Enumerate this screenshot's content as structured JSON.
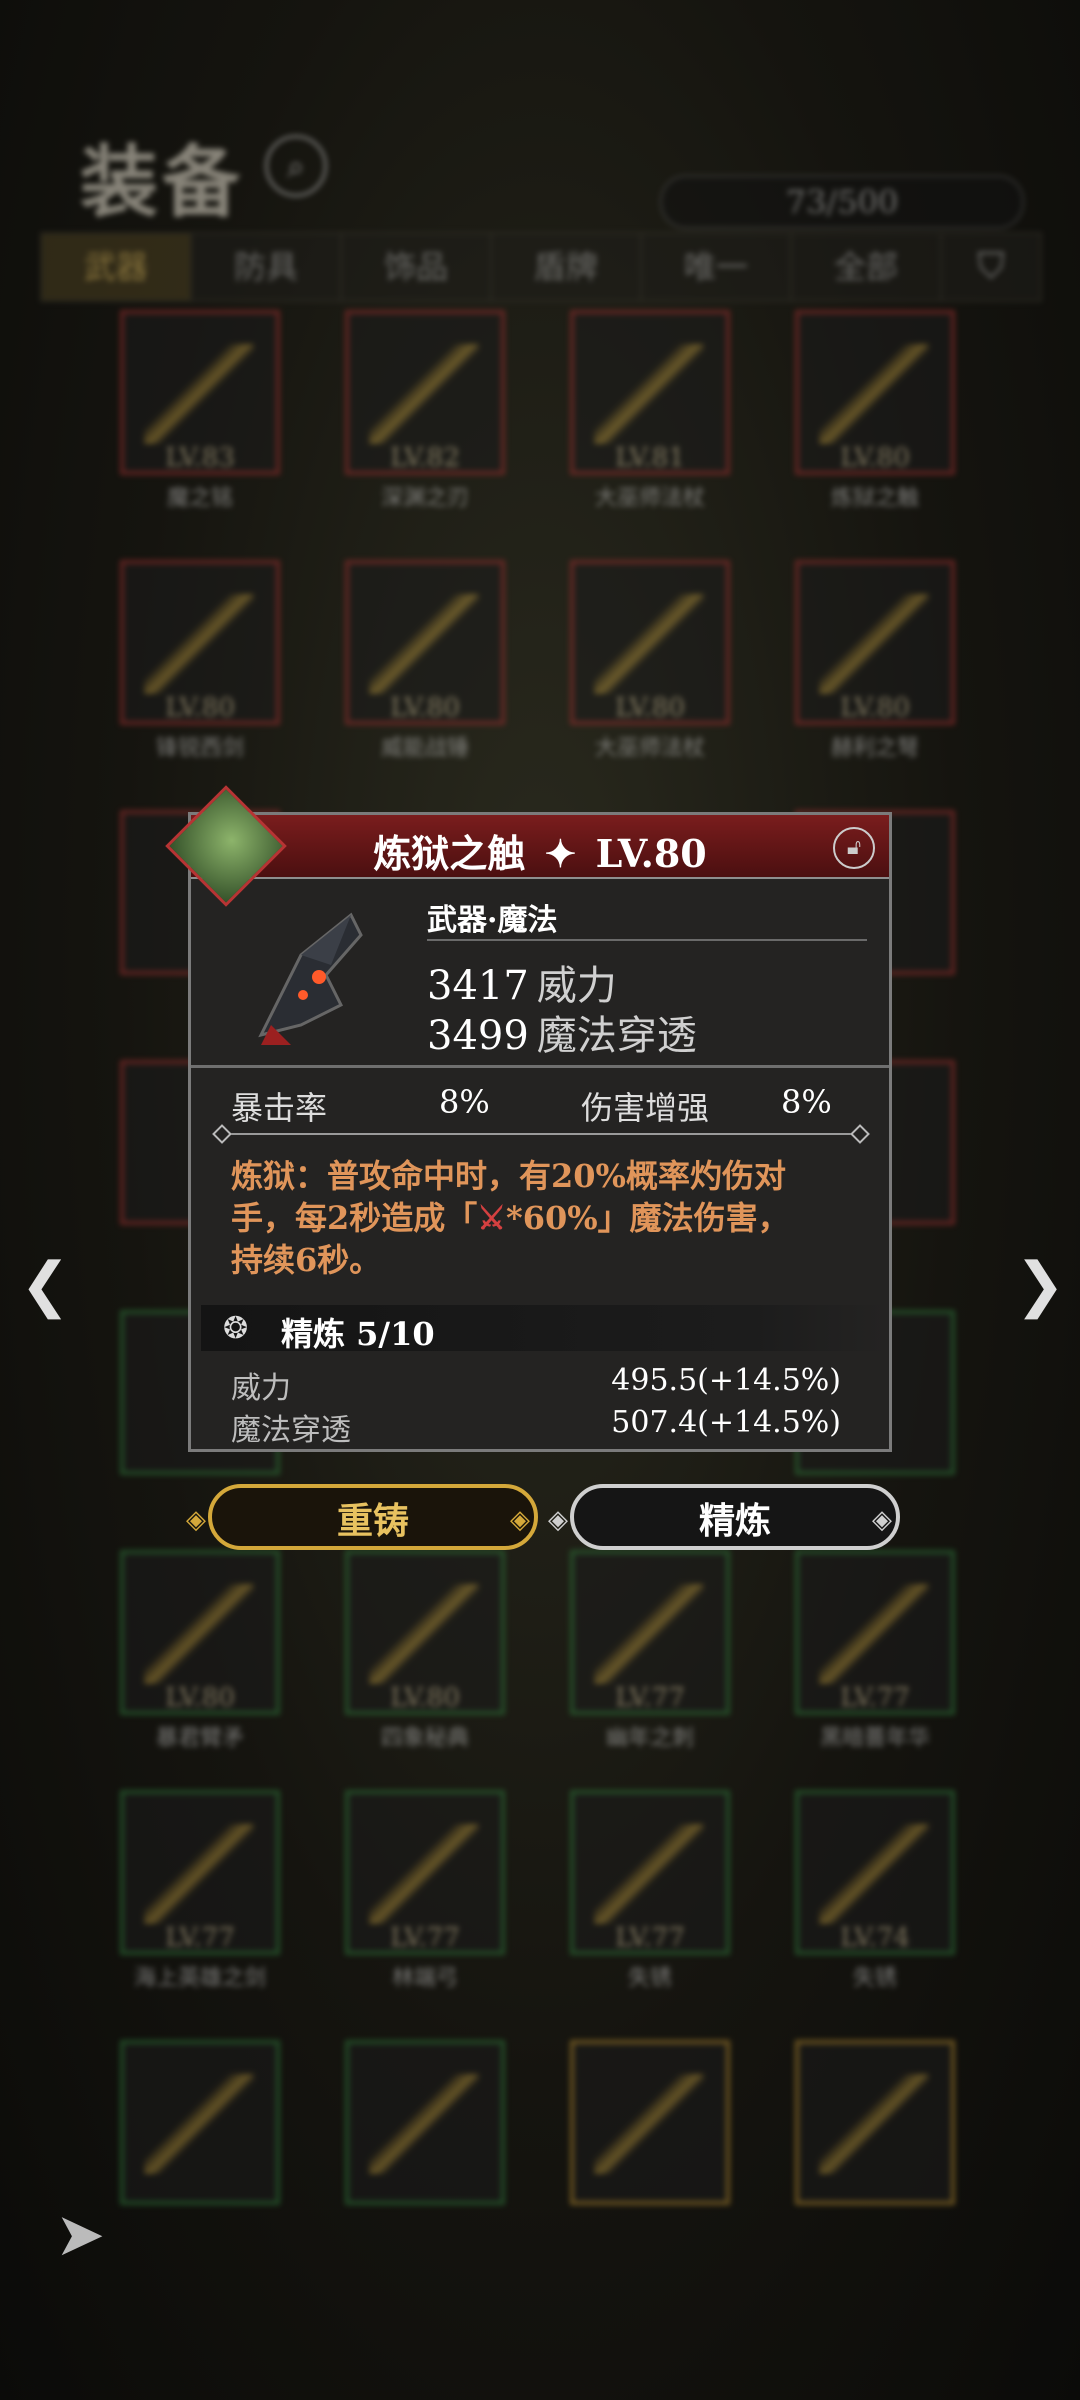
{
  "header": {
    "title": "装备",
    "capacity": "73/500"
  },
  "tabs": [
    {
      "label": "武器",
      "active": true
    },
    {
      "label": "防具",
      "active": false
    },
    {
      "label": "饰品",
      "active": false
    },
    {
      "label": "盾牌",
      "active": false
    },
    {
      "label": "唯一",
      "active": false
    },
    {
      "label": "全部",
      "active": false
    }
  ],
  "grid_items": [
    {
      "level": "LV.83",
      "name": "魔之铭",
      "border": "red"
    },
    {
      "level": "LV.82",
      "name": "深渊之刃",
      "border": "red"
    },
    {
      "level": "LV.81",
      "name": "大巫师法杖",
      "border": "red"
    },
    {
      "level": "LV.80",
      "name": "炼狱之触",
      "border": "red"
    },
    {
      "level": "LV.80",
      "name": "锋锐西剑",
      "border": "red"
    },
    {
      "level": "LV.80",
      "name": "威能战锤",
      "border": "red"
    },
    {
      "level": "LV.80",
      "name": "大巫师法杖",
      "border": "red"
    },
    {
      "level": "LV.80",
      "name": "赫利之弩",
      "border": "red"
    },
    {
      "level": "LV.80",
      "name": "暴君臂矛",
      "border": "green"
    },
    {
      "level": "LV.80",
      "name": "四象秘典",
      "border": "green"
    },
    {
      "level": "LV.77",
      "name": "幽年之刺",
      "border": "green"
    },
    {
      "level": "LV.77",
      "name": "黑暗薔年华",
      "border": "green"
    },
    {
      "level": "LV.77",
      "name": "海上英雄之剑",
      "border": "green"
    },
    {
      "level": "LV.77",
      "name": "林端弓",
      "border": "green"
    },
    {
      "level": "LV.77",
      "name": "失锈",
      "border": "green"
    },
    {
      "level": "LV.74",
      "name": "失锈",
      "border": "green"
    }
  ],
  "popup": {
    "title": "炼狱之触",
    "level": "LV.80",
    "item_type": "武器·魔法",
    "main_stats": [
      {
        "value": "3417",
        "label": "威力"
      },
      {
        "value": "3499",
        "label": "魔法穿透"
      }
    ],
    "sub_stats": [
      {
        "label": "暴击率",
        "value": "8%"
      },
      {
        "label": "伤害增强",
        "value": "8%"
      }
    ],
    "effect_line1": "炼狱：普攻命中时，有20%概率灼伤对",
    "effect_line2a": "手，每2秒造成「",
    "effect_sword": "⚔",
    "effect_line2b": "*60%」魔法伤害，",
    "effect_line3": "持续6秒。",
    "refine_title": "精炼 5/10",
    "refine_stats": [
      {
        "label": "威力",
        "value": "495.5(+14.5%)"
      },
      {
        "label": "魔法穿透",
        "value": "507.4(+14.5%)"
      }
    ]
  },
  "buttons": {
    "recast": "重铸",
    "refine": "精炼"
  },
  "icons": {
    "search": "search-icon",
    "filter": "filter-icon",
    "lock": "lock-icon",
    "prev": "chevron-left-icon",
    "next": "chevron-right-icon",
    "back": "back-icon"
  },
  "colors": {
    "accent_gold": "#d4a83a",
    "rarity_red": "#9e2f2f",
    "rarity_green": "#2f7a3b",
    "effect_orange": "#e0955a"
  }
}
